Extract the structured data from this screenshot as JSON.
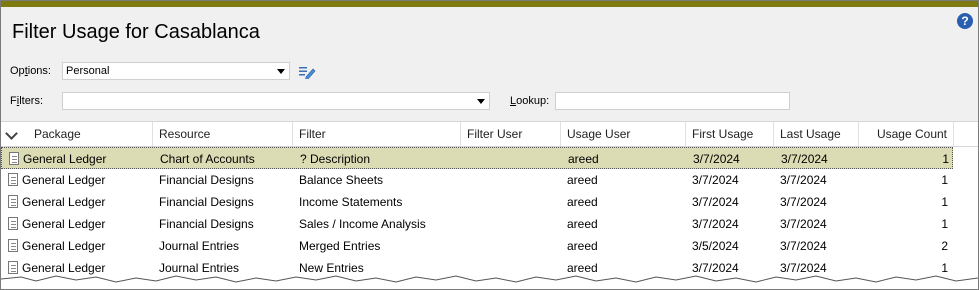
{
  "title": "Filter Usage for Casablanca",
  "options": {
    "label_prefix": "Op",
    "label_key": "t",
    "label_suffix": "ions:",
    "value": "Personal"
  },
  "filters": {
    "label_prefix": "F",
    "label_key": "i",
    "label_suffix": "lters:",
    "value": ""
  },
  "lookup": {
    "label_prefix": "",
    "label_key": "L",
    "label_suffix": "ookup:",
    "value": ""
  },
  "help_glyph": "?",
  "columns": [
    "Package",
    "Resource",
    "Filter",
    "Filter User",
    "Usage User",
    "First Usage",
    "Last Usage",
    "Usage Count"
  ],
  "rows": [
    {
      "package": "General Ledger",
      "resource": "Chart of Accounts",
      "filter": "? Description",
      "filter_user": "",
      "usage_user": "areed",
      "first": "3/7/2024",
      "last": "3/7/2024",
      "count": "1",
      "selected": true
    },
    {
      "package": "General Ledger",
      "resource": "Financial Designs",
      "filter": "Balance Sheets",
      "filter_user": "",
      "usage_user": "areed",
      "first": "3/7/2024",
      "last": "3/7/2024",
      "count": "1",
      "selected": false
    },
    {
      "package": "General Ledger",
      "resource": "Financial Designs",
      "filter": "Income Statements",
      "filter_user": "",
      "usage_user": "areed",
      "first": "3/7/2024",
      "last": "3/7/2024",
      "count": "1",
      "selected": false
    },
    {
      "package": "General Ledger",
      "resource": "Financial Designs",
      "filter": "Sales / Income Analysis",
      "filter_user": "",
      "usage_user": "areed",
      "first": "3/7/2024",
      "last": "3/7/2024",
      "count": "1",
      "selected": false
    },
    {
      "package": "General Ledger",
      "resource": "Journal Entries",
      "filter": "Merged Entries",
      "filter_user": "",
      "usage_user": "areed",
      "first": "3/5/2024",
      "last": "3/7/2024",
      "count": "2",
      "selected": false
    },
    {
      "package": "General Ledger",
      "resource": "Journal Entries",
      "filter": "New Entries",
      "filter_user": "",
      "usage_user": "areed",
      "first": "3/7/2024",
      "last": "3/7/2024",
      "count": "1",
      "selected": false
    }
  ],
  "colors": {
    "accent_bar": "#7f7a10",
    "selected_row": "#dcdcb4",
    "help_icon": "#2a5fb0"
  }
}
